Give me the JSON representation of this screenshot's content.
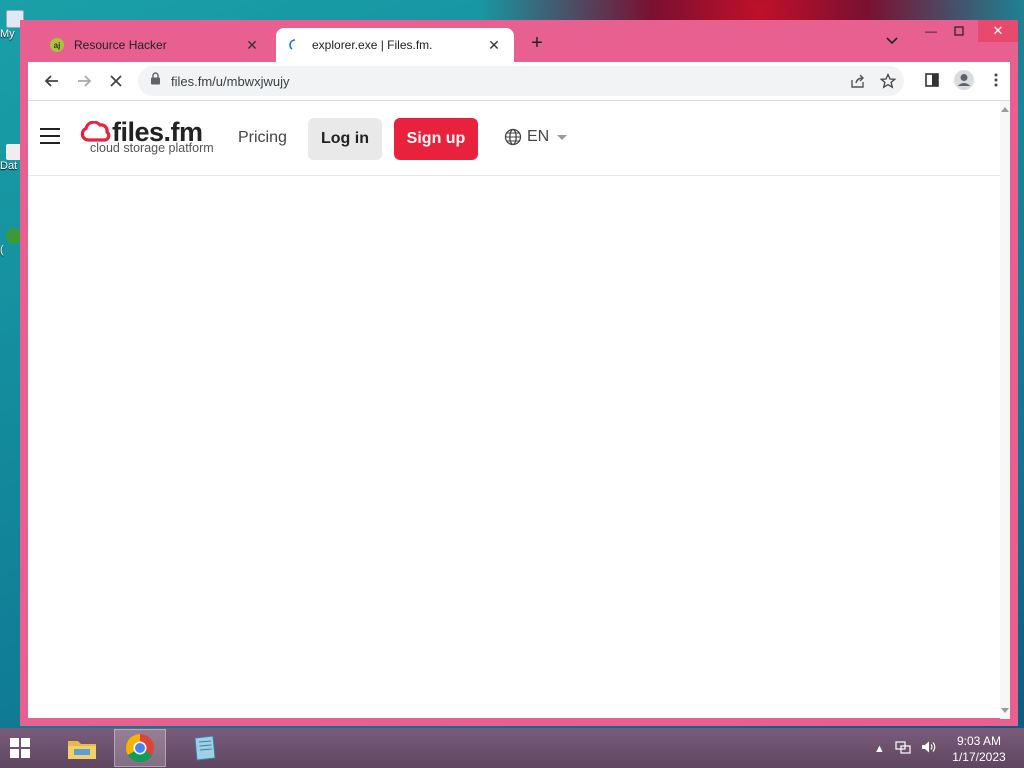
{
  "desktop": {
    "icons": [
      {
        "label": "My"
      },
      {
        "label": "Dat"
      },
      {
        "label": "("
      }
    ]
  },
  "browser": {
    "tabs": [
      {
        "title": "Resource Hacker",
        "favicon": "resource-hacker-icon",
        "active": false
      },
      {
        "title": "explorer.exe | Files.fm.",
        "favicon": "loading-spinner-icon",
        "active": true
      }
    ],
    "url": "files.fm/u/mbwxjwujy",
    "loading": true
  },
  "site": {
    "logo_text": "files.fm",
    "logo_tagline": "cloud storage platform",
    "nav_pricing": "Pricing",
    "login_label": "Log in",
    "signup_label": "Sign up",
    "language": "EN",
    "colors": {
      "brand_red": "#e8213c",
      "login_bg": "#e9e9e9"
    }
  },
  "taskbar": {
    "apps": [
      {
        "name": "file-explorer-icon"
      },
      {
        "name": "chrome-icon",
        "active": true
      },
      {
        "name": "notepad-icon"
      }
    ],
    "time": "9:03 AM",
    "date": "1/17/2023"
  },
  "window_colors": {
    "frame": "#e8608f"
  }
}
